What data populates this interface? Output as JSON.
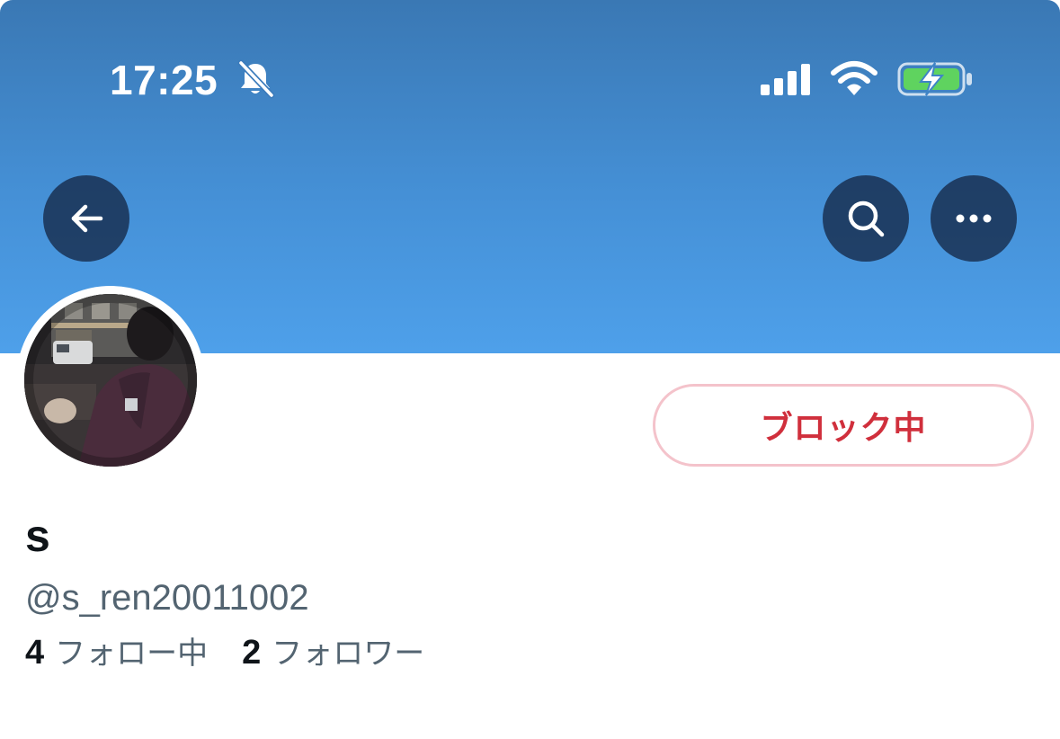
{
  "status_bar": {
    "time": "17:25",
    "icons": [
      "bell-muted-icon",
      "signal-icon",
      "wifi-icon",
      "battery-charging-icon"
    ]
  },
  "navigation": {
    "back": "back-arrow-icon",
    "search": "search-icon",
    "more": "more-icon"
  },
  "profile": {
    "display_name": "s",
    "handle": "@s_ren20011002",
    "following_count": "4",
    "following_label": "フォロー中",
    "followers_count": "2",
    "followers_label": "フォロワー",
    "block_button_label": "ブロック中"
  },
  "colors": {
    "banner_top": "#3a78b4",
    "banner_bottom": "#4ea0ea",
    "blocked_text": "#d02f3c",
    "blocked_border": "#f4c3cb",
    "secondary_text": "#536471",
    "primary_text": "#0f1419"
  }
}
